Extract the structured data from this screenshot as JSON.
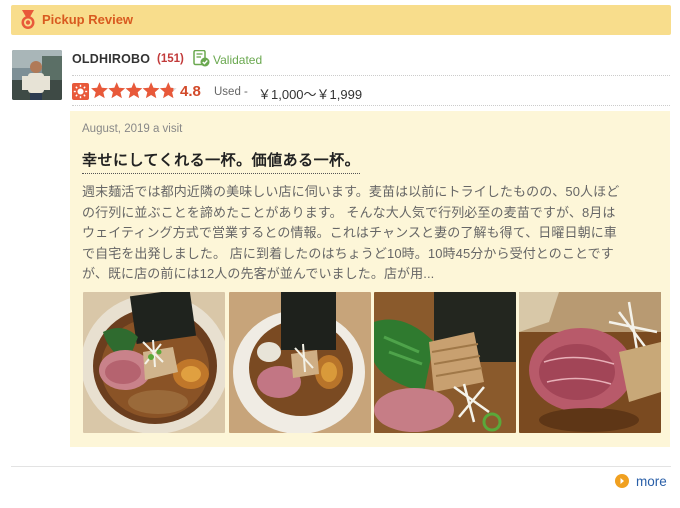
{
  "header": {
    "title": "Pickup Review"
  },
  "reviewer": {
    "name": "OLDHIROBO",
    "review_count": "(151)",
    "validated_label": "Validated"
  },
  "rating": {
    "score": "4.8",
    "score_value": 4.8,
    "max_stars": 5,
    "price_prefix": "Used -",
    "price_range": "￥1,000～￥1,999"
  },
  "review": {
    "visit_date": "August, 2019 a visit",
    "title": "幸せにしてくれる一杯。価値ある一杯。",
    "body_lines": [
      "週末麺活では都内近隣の美味しい店に伺います。麦苗は以前にトライしたものの、50人ほど",
      "の行列に並ぶことを諦めたことがあります。 そんな大人気で行列必至の麦苗ですが、8月は",
      "ウェイティング方式で営業するとの情報。これはチャンスと妻の了解も得て、日曜日朝に車",
      "で自宅を出発しました。 店に到着したのはちょうど10時。10時45分から受付とのことです",
      "が、既に店の前には12人の先客が並んでいました。店が用..."
    ]
  },
  "photos": [
    {
      "name": "ramen-photo-1",
      "icon": "ramen-bowl-top"
    },
    {
      "name": "ramen-photo-2",
      "icon": "ramen-bowl-angle"
    },
    {
      "name": "ramen-photo-3",
      "icon": "ramen-closeup-greens"
    },
    {
      "name": "ramen-photo-4",
      "icon": "ramen-closeup-pork"
    }
  ],
  "footer": {
    "more_label": "more"
  },
  "colors": {
    "header_bg": "#f8dd8c",
    "header_text": "#d85a1f",
    "star": "#e8593a",
    "validated": "#6aa84f",
    "review_bg": "#fdf6d8",
    "link": "#2a5fa8"
  }
}
